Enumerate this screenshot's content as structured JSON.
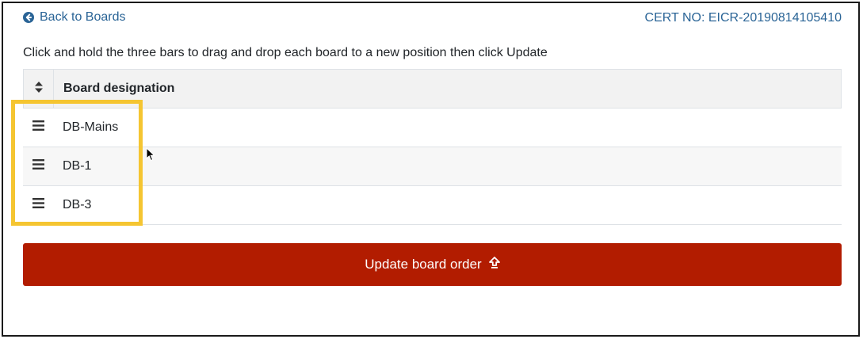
{
  "header": {
    "back_label": "Back to Boards",
    "cert_label": "CERT NO: EICR-20190814105410"
  },
  "instructions": "Click and hold the three bars to drag and drop each board to a new position then click Update",
  "table": {
    "column_header": "Board designation",
    "rows": [
      {
        "label": "DB-Mains"
      },
      {
        "label": "DB-1"
      },
      {
        "label": "DB-3"
      }
    ]
  },
  "update_button": {
    "label": "Update board order"
  },
  "colors": {
    "link": "#2a6496",
    "primary_button": "#b21c00",
    "highlight": "#f5c531"
  },
  "icons": {
    "back": "circle-arrow-left-icon",
    "sort": "sort-icon",
    "drag": "bars-icon",
    "update": "upload-arrow-icon"
  }
}
